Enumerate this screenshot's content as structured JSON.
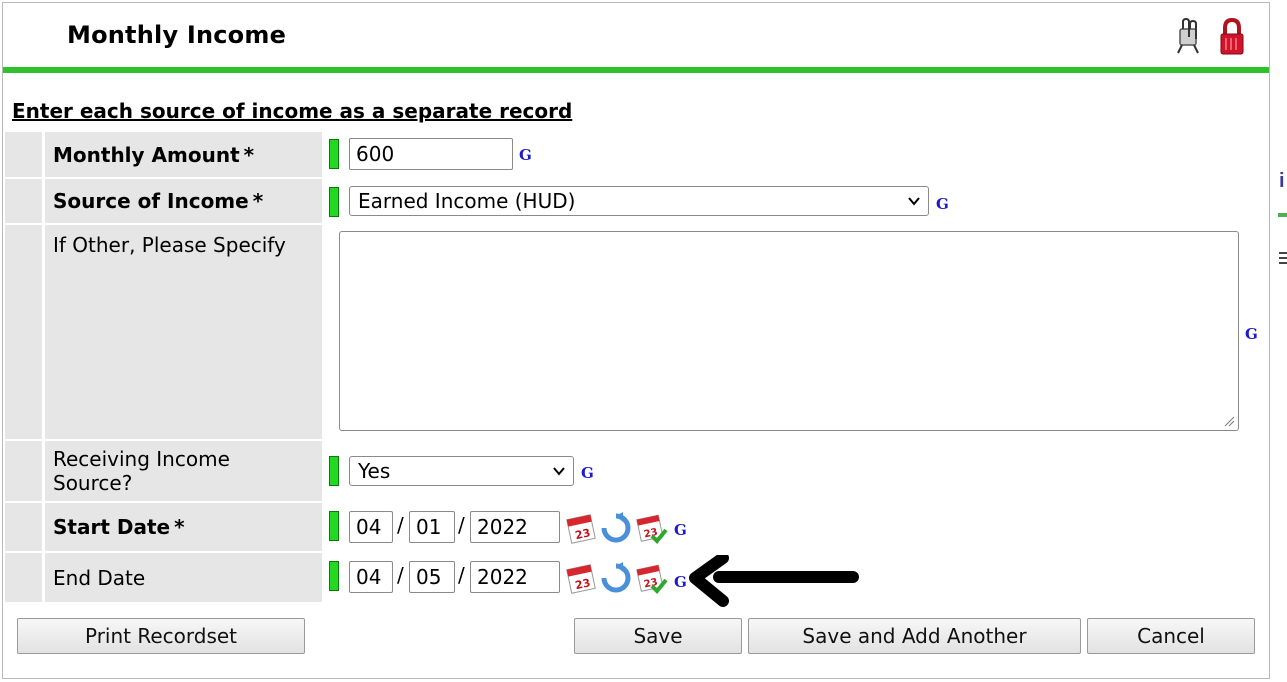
{
  "dialog": {
    "title": "Monthly Income",
    "header_icons": [
      "paperclip-icon",
      "lock-icon"
    ],
    "instruction": "Enter each source of income as a separate record"
  },
  "fields": {
    "monthly_amount": {
      "label": "Monthly Amount",
      "required": "*",
      "value": "600",
      "g": "G"
    },
    "source": {
      "label": "Source of Income",
      "required": "*",
      "value": "Earned Income (HUD)",
      "g": "G"
    },
    "other": {
      "label": "If Other, Please Specify",
      "value": "",
      "g": "G"
    },
    "receiving": {
      "label": "Receiving Income Source?",
      "value": "Yes",
      "g": "G"
    },
    "start_date": {
      "label": "Start Date",
      "required": "*",
      "month": "04",
      "day": "01",
      "year": "2022",
      "sep": "/",
      "g": "G"
    },
    "end_date": {
      "label": "End Date",
      "month": "04",
      "day": "05",
      "year": "2022",
      "sep": "/",
      "g": "G"
    }
  },
  "buttons": {
    "print": "Print Recordset",
    "save": "Save",
    "save_add": "Save and Add Another",
    "cancel": "Cancel"
  },
  "colors": {
    "accent_green": "#2fc12b",
    "flag_green": "#22d822",
    "link_blue": "#1c1cc8",
    "label_bg": "#e6e6e6"
  }
}
